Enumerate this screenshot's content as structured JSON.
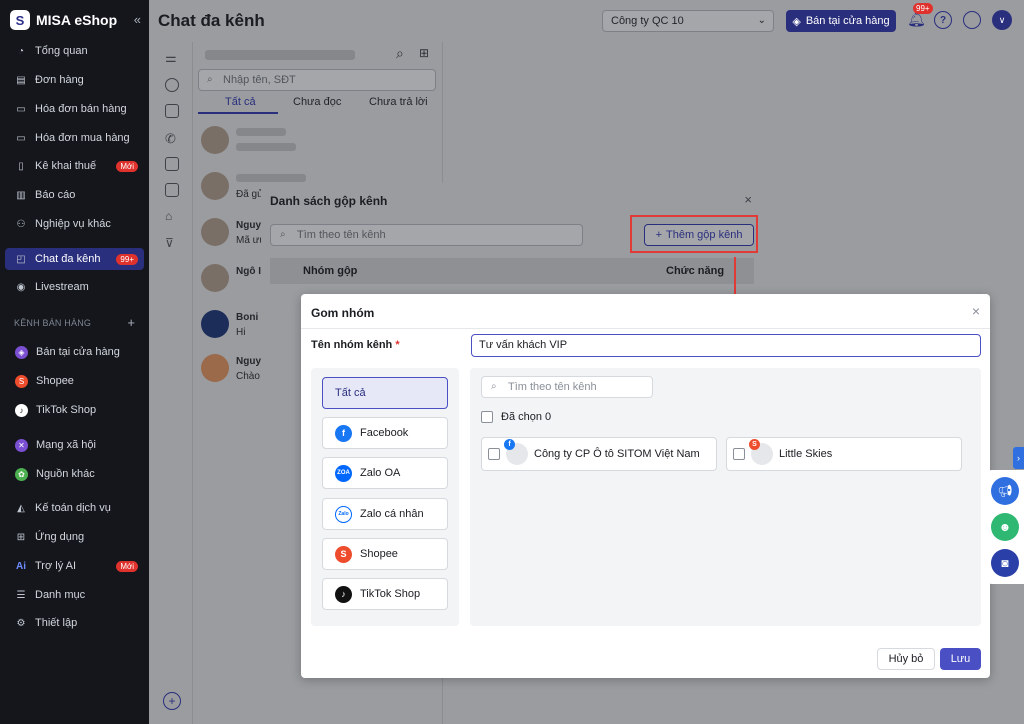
{
  "sidebar": {
    "logo_mark": "S",
    "logo_text": "MISA eShop",
    "collapse_icon": "«",
    "items": [
      {
        "label": "Tổng quan",
        "icon": "dashboard-icon"
      },
      {
        "label": "Đơn hàng",
        "icon": "order-icon"
      },
      {
        "label": "Hóa đơn bán hàng",
        "icon": "sales-invoice-icon"
      },
      {
        "label": "Hóa đơn mua hàng",
        "icon": "purchase-invoice-icon"
      },
      {
        "label": "Kê khai thuế",
        "icon": "tax-icon",
        "badge": "Mới"
      },
      {
        "label": "Báo cáo",
        "icon": "report-icon"
      },
      {
        "label": "Nghiệp vụ khác",
        "icon": "more-ops-icon"
      },
      {
        "label": "Chat đa kênh",
        "icon": "chat-icon",
        "badge": "99+"
      },
      {
        "label": "Livestream",
        "icon": "livestream-icon"
      }
    ],
    "section_label": "KÊNH BÁN HÀNG",
    "section_plus": "+",
    "channels": [
      {
        "label": "Bán tại cửa hàng",
        "color": "#7a4fd1"
      },
      {
        "label": "Shopee",
        "color": "#ee4d2d"
      },
      {
        "label": "TikTok Shop",
        "color": "#ffffff"
      },
      {
        "label": "Mạng xã hội",
        "color": "#7a4fd1"
      },
      {
        "label": "Nguồn khác",
        "color": "#4caf50"
      }
    ],
    "bottom_items": [
      {
        "label": "Kế toán dịch vụ"
      },
      {
        "label": "Ứng dụng"
      },
      {
        "label": "Trợ lý AI",
        "badge": "Mới",
        "prefix": "Ai"
      },
      {
        "label": "Danh mục"
      },
      {
        "label": "Thiết lập"
      }
    ]
  },
  "header": {
    "title": "Chat đa kênh",
    "company": "Công ty QC 10",
    "store_button": "Bán tại cửa hàng",
    "bell_badge": "99+",
    "help_icon": "?",
    "avatar": "∨"
  },
  "conversations": {
    "search_placeholder": "Nhập tên, SĐT",
    "tabs": [
      "Tất cả",
      "Chưa đọc",
      "Chưa trả lời"
    ],
    "rows": [
      {
        "name": "",
        "msg": ""
      },
      {
        "name": "",
        "msg": "Đã gửi"
      },
      {
        "name": "Nguy",
        "msg": "Mã ưu"
      },
      {
        "name": "Ngô I",
        "msg": ""
      },
      {
        "name": "Boni S",
        "msg": "Hi"
      },
      {
        "name": "Nguy",
        "msg": "Chào"
      }
    ]
  },
  "dialog_list": {
    "title": "Danh sách gộp kênh",
    "close": "×",
    "search_placeholder": "Tìm theo tên kênh",
    "add_button": "Thêm gộp kênh",
    "col_group": "Nhóm gộp",
    "col_action": "Chức năng"
  },
  "dialog_group": {
    "title": "Gom nhóm",
    "close": "×",
    "name_label": "Tên nhóm kênh",
    "required_mark": "*",
    "name_value": "Tư vấn khách VIP",
    "channels": [
      {
        "label": "Tất cả",
        "icon": "",
        "color": ""
      },
      {
        "label": "Facebook",
        "icon": "f",
        "color": "#1877f2"
      },
      {
        "label": "Zalo OA",
        "icon": "ZOA",
        "color": "#0068ff"
      },
      {
        "label": "Zalo cá nhân",
        "icon": "Zalo",
        "color": "#0068ff"
      },
      {
        "label": "Shopee",
        "icon": "S",
        "color": "#ee4d2d"
      },
      {
        "label": "TikTok Shop",
        "icon": "♪",
        "color": "#111111"
      }
    ],
    "search_placeholder": "Tìm theo tên kênh",
    "selected_text": "Đã chọn 0",
    "cards": [
      {
        "label": "Công ty CP Ô tô SITOM Việt Nam",
        "badge": "f",
        "badge_color": "#1877f2"
      },
      {
        "label": "Little Skies",
        "badge": "S",
        "badge_color": "#ee4d2d"
      }
    ],
    "cancel_button": "Hủy bỏ",
    "save_button": "Lưu"
  },
  "floating": {
    "tab_icon": "›"
  }
}
